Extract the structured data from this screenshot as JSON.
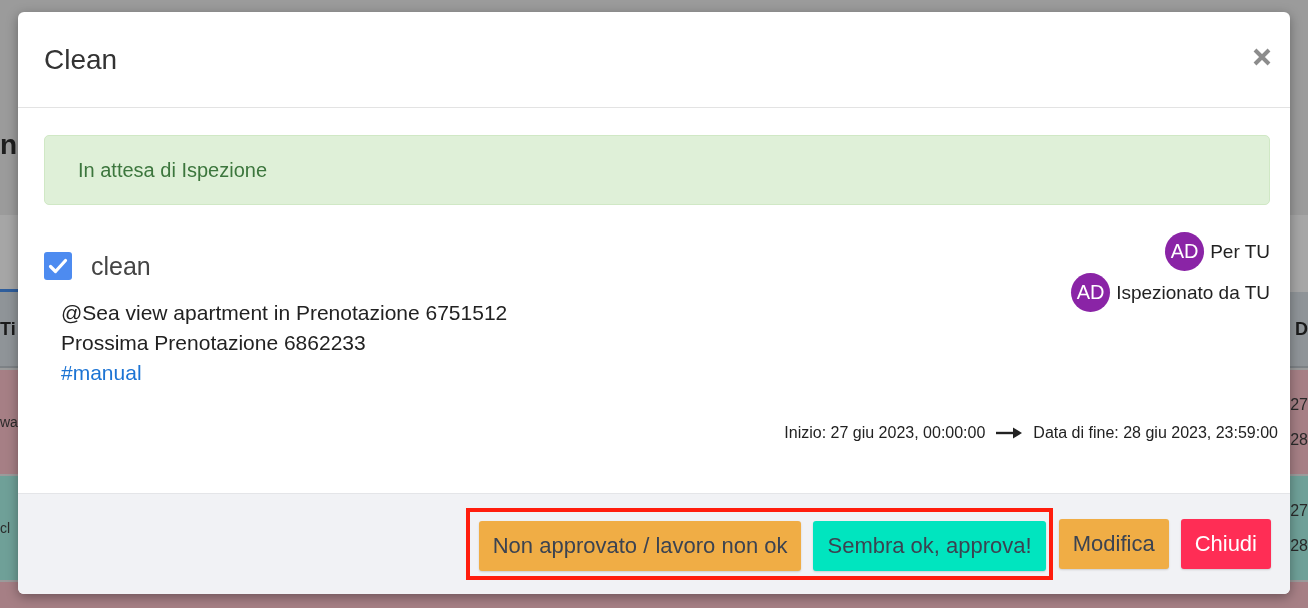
{
  "background": {
    "heading": "n",
    "table": {
      "header": {
        "column_1": "Ti",
        "column_2": "D"
      },
      "rows": [
        {
          "column_1": "wa",
          "column_2": [
            "27",
            "28"
          ],
          "color": "#a67f85"
        },
        {
          "column_1": "cl",
          "column_2": [
            "27",
            "28"
          ],
          "color": "#6fa098"
        },
        {
          "color": "#a67f85"
        }
      ]
    }
  },
  "modal": {
    "title": "Clean",
    "alert": {
      "kind": "success",
      "text": "In attesa di Ispezione"
    },
    "task": {
      "checked": true,
      "name": "clean",
      "details": [
        "@Sea view apartment in Prenotazione 6751512",
        "Prossima Prenotazione 6862233"
      ],
      "tag": "#manual",
      "assignees": [
        {
          "initials": "AD",
          "label": "Per TU"
        },
        {
          "initials": "AD",
          "label": "Ispezionato da TU"
        }
      ],
      "start": "Inizio: 27 giu 2023, 00:00:00",
      "end": "Data di fine: 28 giu 2023, 23:59:00"
    },
    "footer": {
      "highlighted_buttons": [
        {
          "label": "Non approvato / lavoro non ok",
          "kind": "warning"
        },
        {
          "label": "Sembra ok, approva!",
          "kind": "success"
        }
      ],
      "buttons": [
        {
          "label": "Modifica",
          "kind": "warning"
        },
        {
          "label": "Chiudi",
          "kind": "danger"
        }
      ]
    }
  }
}
